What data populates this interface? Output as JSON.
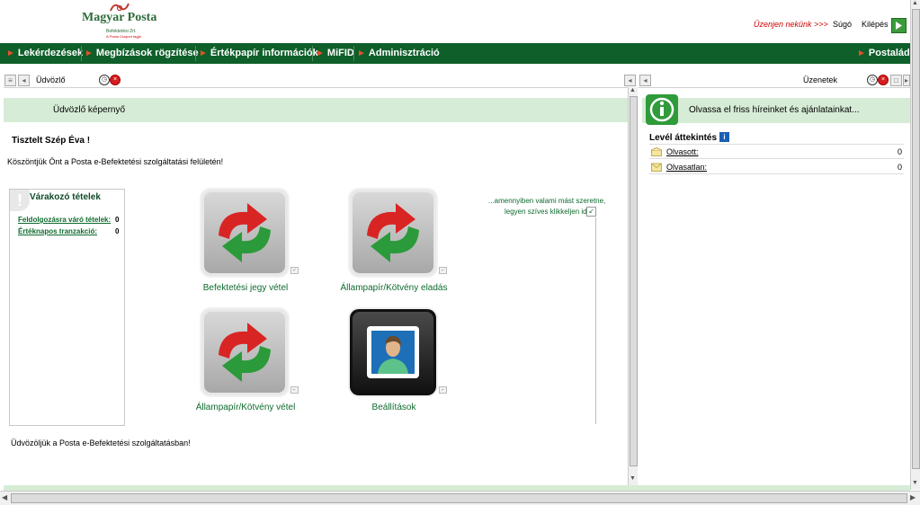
{
  "header": {
    "logo_name": "Magyar Posta",
    "logo_sub": "Befektetési Zrt.",
    "logo_sub2": "A Posta Csoport tagja",
    "message_us": "Üzenjen nekünk >>>",
    "help": "Súgó",
    "exit": "Kilépés"
  },
  "nav": {
    "items": [
      "Lekérdezések",
      "Megbízások rögzítése",
      "Értékpapír információk",
      "MiFID",
      "Adminisztráció"
    ],
    "right": "Postaláda"
  },
  "left_panel": {
    "title": "Üdvözlő",
    "banner": "Üdvözlő képernyő",
    "greeting": "Tisztelt  Szép Éva !",
    "intro": "Köszöntjük Önt a Posta e-Befektetési szolgáltatási felületén!",
    "waiting": {
      "title": "Várakozó tételek",
      "rows": [
        {
          "label": "Feldolgozásra váró tételek:",
          "value": "0"
        },
        {
          "label": "Értéknapos tranzakció:",
          "value": "0"
        }
      ]
    },
    "hint_line1": "...amennyiben valami mást szeretne,",
    "hint_line2": "legyen szíves klikkeljen ide",
    "tiles": [
      {
        "label": "Befektetési jegy vétel",
        "icon": "exchange-arrows-icon"
      },
      {
        "label": "Állampapír/Kötvény eladás",
        "icon": "exchange-arrows-icon"
      },
      {
        "label": "Állampapír/Kötvény vétel",
        "icon": "exchange-arrows-icon"
      },
      {
        "label": "Beállítások",
        "icon": "user-portrait-icon"
      }
    ],
    "footer": "Üdvözöljük a Posta e-Befektetési szolgáltatásban!"
  },
  "right_panel": {
    "title": "Üzenetek",
    "banner": "Olvassa el friss híreinket és ajánlatainkat...",
    "overview_title": "Levél áttekintés",
    "rows": [
      {
        "label": "Olvasott:",
        "value": "0"
      },
      {
        "label": "Olvasatlan:",
        "value": "0"
      }
    ]
  },
  "colors": {
    "nav_bg": "#0e5f2a",
    "accent": "#e8502a",
    "banner_bg": "#d6ecd6",
    "link": "#0e6a2e"
  }
}
